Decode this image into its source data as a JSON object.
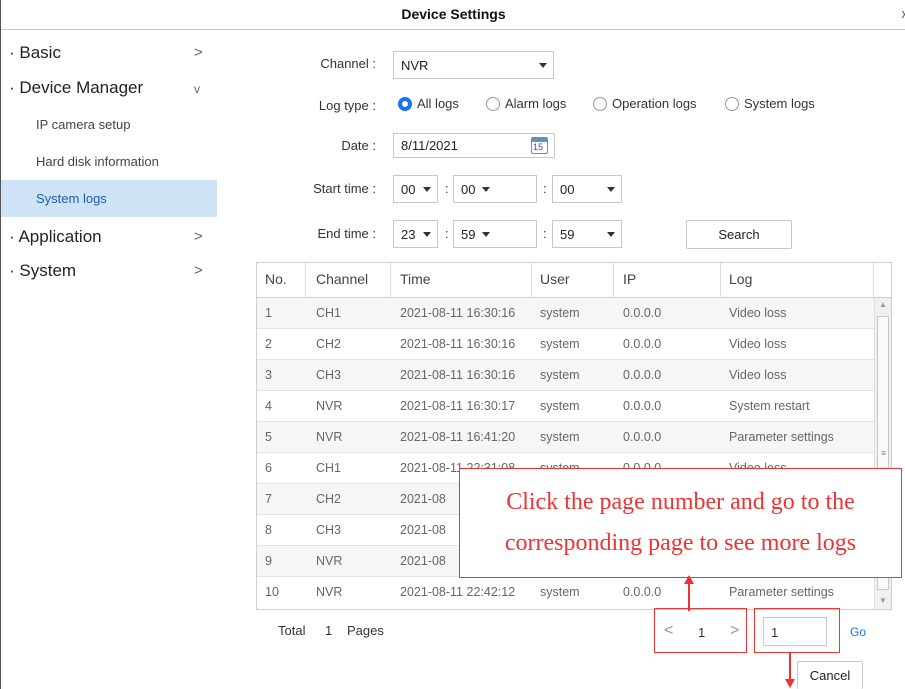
{
  "window": {
    "title": "Device Settings",
    "close_glyph": "x"
  },
  "sidebar": {
    "items": [
      {
        "label": "· Basic",
        "chevron": ">"
      },
      {
        "label": "· Device Manager",
        "chevron": "v"
      },
      {
        "label": "IP camera setup"
      },
      {
        "label": "Hard disk information"
      },
      {
        "label": "System logs",
        "active": true
      },
      {
        "label": "· Application",
        "chevron": ">"
      },
      {
        "label": "· System",
        "chevron": ">"
      }
    ]
  },
  "form": {
    "channel_label": "Channel :",
    "channel_value": "NVR",
    "logtype_label": "Log type :",
    "logtypes": [
      {
        "label": "All logs",
        "selected": true
      },
      {
        "label": "Alarm logs"
      },
      {
        "label": "Operation logs"
      },
      {
        "label": "System logs"
      }
    ],
    "date_label": "Date :",
    "date_value": "8/11/2021",
    "calendar_day": "15",
    "start_label": "Start time :",
    "start": {
      "h": "00",
      "m": "00",
      "s": "00"
    },
    "end_label": "End time :",
    "end": {
      "h": "23",
      "m": "59",
      "s": "59"
    },
    "colon": ":",
    "search_label": "Search"
  },
  "table": {
    "headers": [
      "No.",
      "Channel",
      "Time",
      "User",
      "IP",
      "Log"
    ],
    "rows": [
      [
        "1",
        "CH1",
        "2021-08-11 16:30:16",
        "system",
        "0.0.0.0",
        "Video loss"
      ],
      [
        "2",
        "CH2",
        "2021-08-11 16:30:16",
        "system",
        "0.0.0.0",
        "Video loss"
      ],
      [
        "3",
        "CH3",
        "2021-08-11 16:30:16",
        "system",
        "0.0.0.0",
        "Video loss"
      ],
      [
        "4",
        "NVR",
        "2021-08-11 16:30:17",
        "system",
        "0.0.0.0",
        "System restart"
      ],
      [
        "5",
        "NVR",
        "2021-08-11 16:41:20",
        "system",
        "0.0.0.0",
        "Parameter settings"
      ],
      [
        "6",
        "CH1",
        "2021-08-11 22:31:08",
        "system",
        "0.0.0.0",
        "Video loss"
      ],
      [
        "7",
        "CH2",
        "2021-08",
        "",
        "",
        ""
      ],
      [
        "8",
        "CH3",
        "2021-08",
        "",
        "",
        ""
      ],
      [
        "9",
        "NVR",
        "2021-08",
        "",
        "",
        ""
      ],
      [
        "10",
        "NVR",
        "2021-08-11 22:42:12",
        "system",
        "0.0.0.0",
        "Parameter settings"
      ]
    ]
  },
  "pagination": {
    "total_label": "Total",
    "total_pages": "1",
    "pages_label": "Pages",
    "prev": "<",
    "current_page": "1",
    "next": ">",
    "goto_value": "1",
    "go_label": "Go"
  },
  "annotation": {
    "line1": "Click the page number and go to the",
    "line2": "corresponding page to see more logs",
    "color": "#e33333"
  },
  "footer": {
    "cancel_label": "Cancel"
  }
}
